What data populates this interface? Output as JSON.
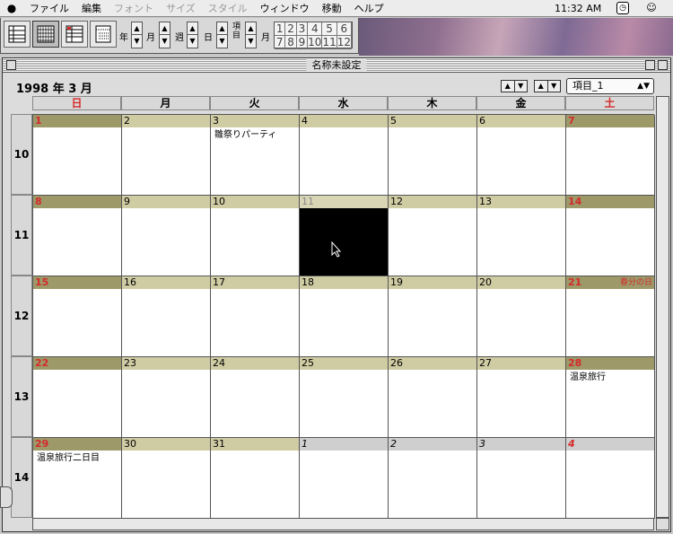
{
  "menubar": {
    "menus": [
      {
        "label": "ファイル",
        "enabled": true
      },
      {
        "label": "編集",
        "enabled": true
      },
      {
        "label": "フォント",
        "enabled": false
      },
      {
        "label": "サイズ",
        "enabled": false
      },
      {
        "label": "スタイル",
        "enabled": false
      },
      {
        "label": "ウィンドウ",
        "enabled": true
      },
      {
        "label": "移動",
        "enabled": true
      },
      {
        "label": "ヘルプ",
        "enabled": true
      }
    ],
    "clock": "11:32 AM"
  },
  "toolbar": {
    "year_label": "年",
    "month_label": "月",
    "week_label": "週",
    "day_label": "日",
    "item_label": "項目",
    "month_label2": "月",
    "months": [
      "1",
      "2",
      "3",
      "4",
      "5",
      "6",
      "7",
      "8",
      "9",
      "10",
      "11",
      "12"
    ]
  },
  "window": {
    "title": "名称未設定",
    "month_title": "1998 年  3 月",
    "item_select": "項目_1"
  },
  "weekdays": [
    "日",
    "月",
    "火",
    "水",
    "木",
    "金",
    "土"
  ],
  "weeks": [
    "10",
    "11",
    "12",
    "13",
    "14"
  ],
  "days": [
    {
      "num": "1",
      "red": true,
      "weekend": true
    },
    {
      "num": "2"
    },
    {
      "num": "3",
      "event": "雛祭りパーティ"
    },
    {
      "num": "4"
    },
    {
      "num": "5"
    },
    {
      "num": "6"
    },
    {
      "num": "7",
      "red": true,
      "weekend": true
    },
    {
      "num": "8",
      "red": true,
      "weekend": true
    },
    {
      "num": "9"
    },
    {
      "num": "10"
    },
    {
      "num": "11",
      "selected": true
    },
    {
      "num": "12"
    },
    {
      "num": "13"
    },
    {
      "num": "14",
      "red": true,
      "weekend": true
    },
    {
      "num": "15",
      "red": true,
      "weekend": true
    },
    {
      "num": "16"
    },
    {
      "num": "17"
    },
    {
      "num": "18"
    },
    {
      "num": "19"
    },
    {
      "num": "20"
    },
    {
      "num": "21",
      "red": true,
      "weekend": true,
      "holiday": "春分の日"
    },
    {
      "num": "22",
      "red": true,
      "weekend": true
    },
    {
      "num": "23"
    },
    {
      "num": "24"
    },
    {
      "num": "25"
    },
    {
      "num": "26"
    },
    {
      "num": "27"
    },
    {
      "num": "28",
      "red": true,
      "weekend": true,
      "event": "温泉旅行"
    },
    {
      "num": "29",
      "red": true,
      "weekend": true,
      "event": "温泉旅行二日目"
    },
    {
      "num": "30"
    },
    {
      "num": "31"
    },
    {
      "num": "1",
      "other": true
    },
    {
      "num": "2",
      "other": true
    },
    {
      "num": "3",
      "other": true
    },
    {
      "num": "4",
      "other": true,
      "red": true
    }
  ],
  "colors": {
    "weekday_header": "#cfcca4",
    "weekend_header": "#9d9968",
    "holiday_red": "#d42a2a"
  }
}
